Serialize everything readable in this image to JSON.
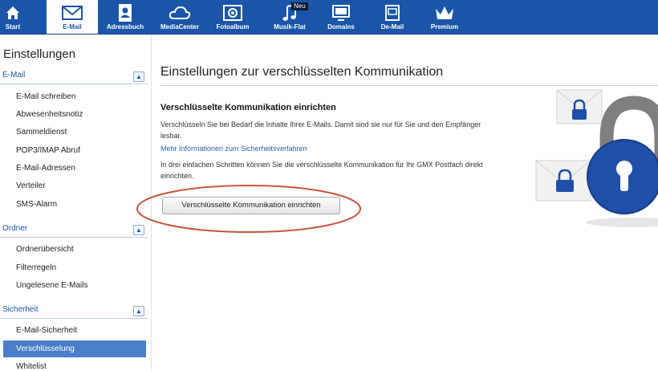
{
  "nav": {
    "items": [
      {
        "label": "Start",
        "icon": "home-icon"
      },
      {
        "label": "E-Mail",
        "icon": "envelope-icon"
      },
      {
        "label": "Adressbuch",
        "icon": "address-book-icon"
      },
      {
        "label": "MediaCenter",
        "icon": "cloud-icon"
      },
      {
        "label": "Fotoalbum",
        "icon": "camera-icon"
      },
      {
        "label": "Musik-Flat",
        "icon": "music-note-icon"
      },
      {
        "label": "Domains",
        "icon": "monitor-icon"
      },
      {
        "label": "De-Mail",
        "icon": "de-mail-icon"
      },
      {
        "label": "Premium",
        "icon": "crown-icon"
      }
    ],
    "badge": "Neu",
    "active": "E-Mail"
  },
  "sidebar": {
    "title": "Einstellungen",
    "sections": [
      {
        "title": "E-Mail",
        "items": [
          "E-Mail schreiben",
          "Abwesenheitsnotiz",
          "Sammeldienst",
          "POP3/IMAP Abruf",
          "E-Mail-Adressen",
          "Verteiler",
          "SMS-Alarm"
        ]
      },
      {
        "title": "Ordner",
        "items": [
          "Ordnerübersicht",
          "Filterregeln",
          "Ungelesene E-Mails"
        ]
      },
      {
        "title": "Sicherheit",
        "items": [
          "E-Mail-Sicherheit",
          "Verschlüsselung",
          "Whitelist"
        ]
      }
    ],
    "selected": "Verschlüsselung"
  },
  "main": {
    "title": "Einstellungen zur verschlüsselten Kommunikation",
    "subtitle": "Verschlüsselte Kommunikation einrichten",
    "description": "Verschlüsseln Sie bei Bedarf die Inhalte Ihrer E-Mails. Damit sind sie nur für Sie und den Empfänger lesbar.",
    "link": "Mehr Informationen zum Sicherheitsverfahren",
    "steps_text": "In drei einfachen Schritten können Sie die verschlüsselte Kommunikation für Ihr GMX Postfach direkt einrichten.",
    "button": "Verschlüsselte Kommunikation einrichten"
  },
  "colors": {
    "nav_bg": "#1a55a8",
    "selected_bg": "#4a7ec7",
    "link": "#2f5ea8",
    "highlight_ellipse": "#c9533f",
    "lock_blue": "#1f4fa8"
  }
}
